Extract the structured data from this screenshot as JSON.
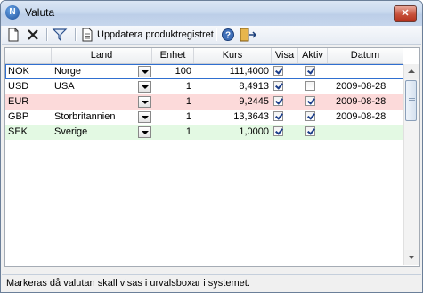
{
  "window": {
    "title": "Valuta",
    "app_icon_letter": "N",
    "close_label": "✕"
  },
  "toolbar": {
    "update_label": "Uppdatera produktregistret",
    "icons": [
      "new-document-icon",
      "delete-icon",
      "filter-icon",
      "update-document-icon",
      "help-icon",
      "exit-icon"
    ]
  },
  "grid": {
    "headers": {
      "code": "",
      "land": "Land",
      "enhet": "Enhet",
      "kurs": "Kurs",
      "visa": "Visa",
      "aktiv": "Aktiv",
      "datum": "Datum"
    },
    "rows": [
      {
        "code": "NOK",
        "land": "Norge",
        "enhet": "100",
        "kurs": "111,4000",
        "visa": true,
        "aktiv": true,
        "datum": "",
        "bg": "#ffffff"
      },
      {
        "code": "USD",
        "land": "USA",
        "enhet": "1",
        "kurs": "8,4913",
        "visa": true,
        "aktiv": false,
        "datum": "2009-08-28",
        "bg": "#ffffff"
      },
      {
        "code": "EUR",
        "land": "",
        "enhet": "1",
        "kurs": "9,2445",
        "visa": true,
        "aktiv": true,
        "datum": "2009-08-28",
        "bg": "#fcdada"
      },
      {
        "code": "GBP",
        "land": "Storbritannien",
        "enhet": "1",
        "kurs": "13,3643",
        "visa": true,
        "aktiv": true,
        "datum": "2009-08-28",
        "bg": "#ffffff"
      },
      {
        "code": "SEK",
        "land": "Sverige",
        "enhet": "1",
        "kurs": "1,0000",
        "visa": true,
        "aktiv": true,
        "datum": "",
        "bg": "#e3f9e3"
      }
    ]
  },
  "status": {
    "text": "Markeras då valutan skall visas i urvalsboxar i systemet."
  }
}
